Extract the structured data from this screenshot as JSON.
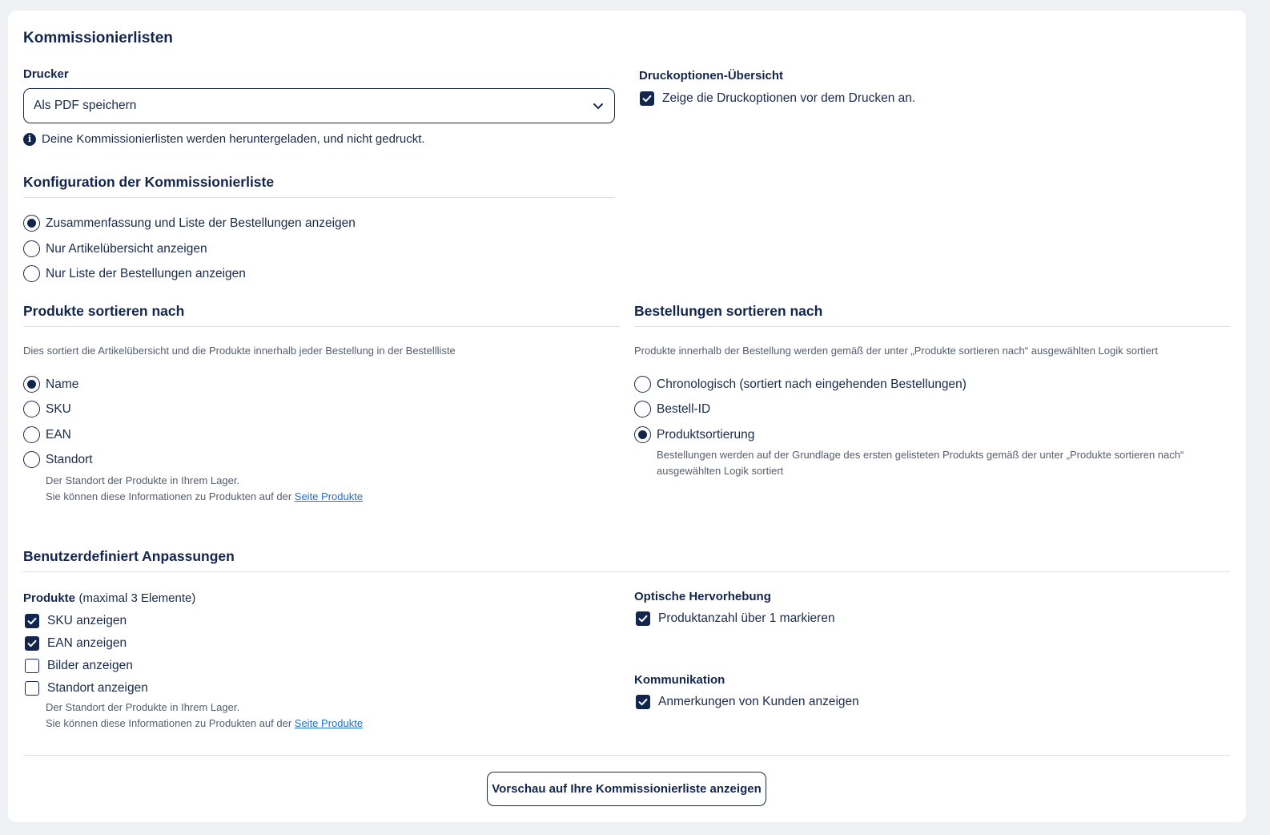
{
  "page": {
    "title": "Kommissionierlisten",
    "printer": {
      "label": "Drucker",
      "selected": "Als PDF speichern",
      "info": "Deine Kommissionierlisten werden heruntergeladen, und nicht gedruckt."
    },
    "print_overview": {
      "label": "Druckoptionen-Übersicht",
      "checkbox_label": "Zeige die Druckoptionen vor dem Drucken an.",
      "checked": true
    },
    "config": {
      "heading": "Konfiguration der Kommissionierliste",
      "options": [
        {
          "label": "Zusammenfassung und Liste der Bestellungen anzeigen",
          "selected": true
        },
        {
          "label": "Nur Artikelübersicht anzeigen",
          "selected": false
        },
        {
          "label": "Nur Liste der Bestellungen anzeigen",
          "selected": false
        }
      ]
    },
    "product_sort": {
      "heading": "Produkte sortieren nach",
      "description": "Dies sortiert die Artikelübersicht und die Produkte innerhalb jeder Bestellung in der Bestellliste",
      "options": [
        {
          "label": "Name",
          "selected": true
        },
        {
          "label": "SKU",
          "selected": false
        },
        {
          "label": "EAN",
          "selected": false
        },
        {
          "label": "Standort",
          "selected": false
        }
      ],
      "standort_note_1": "Der Standort der Produkte in Ihrem Lager.",
      "standort_note_2": "Sie können diese Informationen zu Produkten auf der",
      "standort_link": "Seite Produkte"
    },
    "order_sort": {
      "heading": "Bestellungen sortieren nach",
      "description": "Produkte innerhalb der Bestellung werden gemäß der unter „Produkte sortieren nach“ ausgewählten Logik sortiert",
      "options": [
        {
          "label": "Chronologisch (sortiert nach eingehenden Bestellungen)",
          "selected": false
        },
        {
          "label": "Bestell-ID",
          "selected": false
        },
        {
          "label": "Produktsortierung",
          "selected": true
        }
      ],
      "note_1": "Bestellungen werden auf der Grundlage des ersten gelisteten Produkts gemäß der unter „Produkte sortieren nach“",
      "note_2": "ausgewählten Logik sortiert"
    },
    "custom": {
      "heading": "Benutzerdefiniert Anpassungen",
      "products_label": "Produkte",
      "products_hint": "(maximal 3 Elemente)",
      "product_options": [
        {
          "label": "SKU anzeigen",
          "checked": true
        },
        {
          "label": "EAN anzeigen",
          "checked": true
        },
        {
          "label": "Bilder anzeigen",
          "checked": false
        },
        {
          "label": "Standort anzeigen",
          "checked": false
        }
      ],
      "standort_note_1": "Der Standort der Produkte in Ihrem Lager.",
      "standort_note_2": "Sie können diese Informationen zu Produkten auf der",
      "standort_link": "Seite Produkte",
      "highlight_label": "Optische Hervorhebung",
      "highlight_option": {
        "label": "Produktanzahl über 1 markieren",
        "checked": true
      },
      "communication_label": "Kommunikation",
      "communication_option": {
        "label": "Anmerkungen von Kunden anzeigen",
        "checked": true
      }
    },
    "preview_button": "Vorschau auf Ihre Kommissionierliste anzeigen"
  }
}
